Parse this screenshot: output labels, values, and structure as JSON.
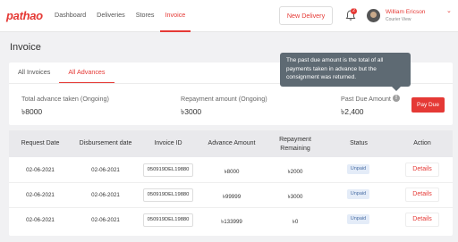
{
  "header": {
    "logo": "pathao",
    "nav": [
      "Dashboard",
      "Deliveries",
      "Stores",
      "Invoice"
    ],
    "new_delivery": "New Delivery",
    "notification_count": "2",
    "user_name": "William Ericson",
    "user_role": "Courier View"
  },
  "page": {
    "title": "Invoice"
  },
  "tabs": [
    "All Invoices",
    "All Advances"
  ],
  "stats": {
    "advance_label": "Total advance taken (Ongoing)",
    "advance_value": "৳8000",
    "repayment_label": "Repayment amount (Ongoing)",
    "repayment_value": "৳3000",
    "pastdue_label": "Past Due Amount",
    "pastdue_value": "৳2,400",
    "pay_due": "Pay Due"
  },
  "tooltip": "The past due amount is the total of all payments taken in advance but the consignment was returned.",
  "table": {
    "headers": [
      "Request Date",
      "Disbursement date",
      "Invoice ID",
      "Advance Amount",
      "Repayment Remaining",
      "Status",
      "Action"
    ],
    "rows": [
      {
        "request": "02-06-2021",
        "disbursement": "02-06-2021",
        "invoice_id": "050919DEL19880",
        "advance": "৳8000",
        "remaining": "৳2000",
        "status": "Unpaid",
        "action": "Details"
      },
      {
        "request": "02-06-2021",
        "disbursement": "02-06-2021",
        "invoice_id": "050919DEL19880",
        "advance": "৳99999",
        "remaining": "৳3000",
        "status": "Unpaid",
        "action": "Details"
      },
      {
        "request": "02-06-2021",
        "disbursement": "02-06-2021",
        "invoice_id": "050919DEL19880",
        "advance": "৳133999",
        "remaining": "৳0",
        "status": "Unpaid",
        "action": "Details"
      }
    ]
  },
  "colors": {
    "accent": "#e53935",
    "status_bg": "#e4ecf8",
    "tooltip_bg": "#5e6a73"
  }
}
